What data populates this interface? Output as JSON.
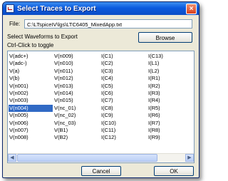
{
  "window": {
    "title": "Select Traces to Export",
    "close_label": "×"
  },
  "file": {
    "label": "File:",
    "value": "C:\\LTspiceIV\\lgs\\LTC6405_MixedApp.txt"
  },
  "browse_label": "Browse",
  "instructions": {
    "line1": "Select Waveforms to Export",
    "line2": "Ctrl-Click to toggle"
  },
  "traces": {
    "columns": [
      [
        "V(adc+)",
        "V(adc-)",
        "V(a)",
        "V(b)",
        "V(n001)",
        "V(n002)",
        "V(n003)",
        "V(n004)",
        "V(n005)",
        "V(n006)",
        "V(n007)",
        "V(n008)"
      ],
      [
        "V(n009)",
        "V(n010)",
        "V(n011)",
        "V(n012)",
        "V(n013)",
        "V(n014)",
        "V(n015)",
        "V(nc_01)",
        "V(nc_02)",
        "V(nc_03)",
        "V(B1)",
        "V(B2)"
      ],
      [
        "I(C1)",
        "I(C2)",
        "I(C3)",
        "I(C4)",
        "I(C5)",
        "I(C6)",
        "I(C7)",
        "I(C8)",
        "I(C9)",
        "I(C10)",
        "I(C11)",
        "I(C12)"
      ],
      [
        "I(C13)",
        "I(L1)",
        "I(L2)",
        "I(R1)",
        "I(R2)",
        "I(R3)",
        "I(R4)",
        "I(R5)",
        "I(R6)",
        "I(R7)",
        "I(R8)",
        "I(R9)"
      ]
    ],
    "selected": "V(n004)"
  },
  "scrollbar": {
    "left_arrow": "◀",
    "right_arrow": "▶"
  },
  "buttons": {
    "cancel": "Cancel",
    "ok": "OK"
  },
  "colors": {
    "title_bar": "#0b5ade",
    "selection": "#316ac5",
    "dialog_bg": "#ece9d8"
  }
}
